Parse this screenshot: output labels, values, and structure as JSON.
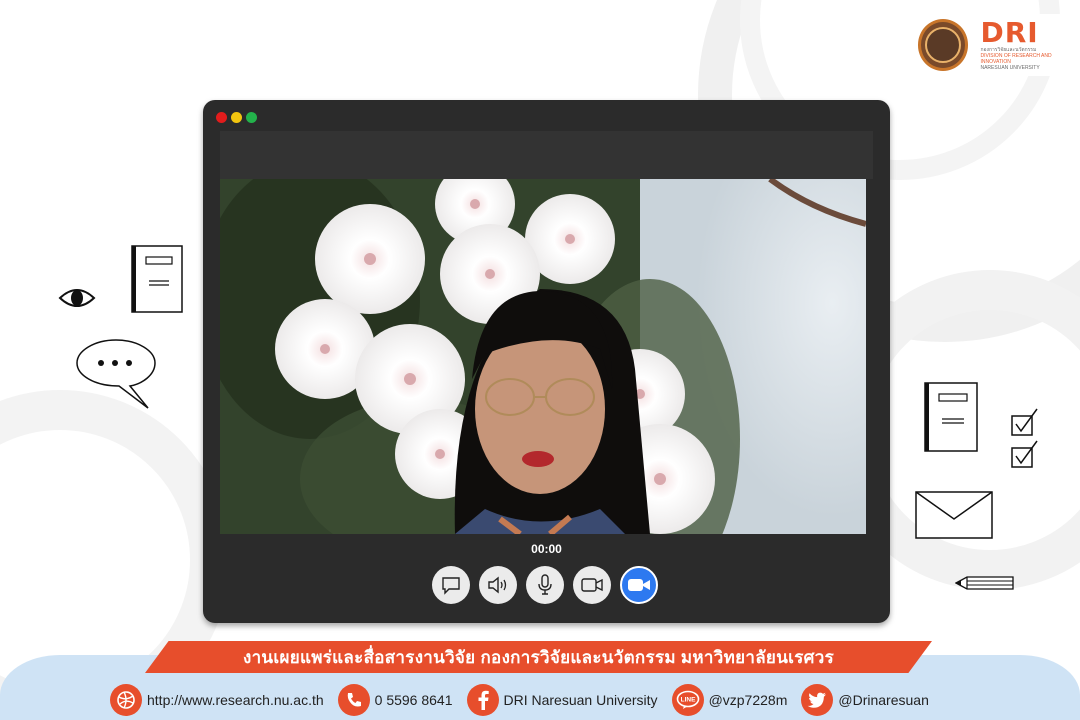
{
  "window": {
    "timer": "00:00",
    "traffic_lights": [
      "#e21c1c",
      "#f2c50f",
      "#23b24b"
    ],
    "controls": [
      {
        "name": "chat-button",
        "icon": "chat-bubble-icon"
      },
      {
        "name": "speaker-button",
        "icon": "speaker-icon"
      },
      {
        "name": "mic-button",
        "icon": "microphone-icon"
      },
      {
        "name": "camera-button",
        "icon": "video-camera-icon"
      },
      {
        "name": "zoom-button",
        "icon": "zoom-camera-icon",
        "active": true
      }
    ]
  },
  "logo": {
    "mark": "DRI",
    "subtitle_lines": [
      "กองการวิจัยและนวัตกรรม",
      "DIVISION OF RESEARCH AND INNOVATION",
      "NARESUAN UNIVERSITY"
    ]
  },
  "banner": {
    "title": "งานเผยแพร่และสื่อสารงานวิจัย กองการวิจัยและนวัตกรรม มหาวิทยาลัยนเรศวร"
  },
  "contacts": [
    {
      "icon": "globe-icon",
      "text": "http://www.research.nu.ac.th"
    },
    {
      "icon": "phone-icon",
      "text": "0 5596 8641"
    },
    {
      "icon": "facebook-icon",
      "text": "DRI Naresuan University"
    },
    {
      "icon": "line-icon",
      "text": "@vzp7228m",
      "icon_label": "LINE"
    },
    {
      "icon": "twitter-icon",
      "text": "@Drinaresuan"
    }
  ],
  "colors": {
    "accent": "#e74e2c",
    "window": "#2b2b2b",
    "zoom_blue": "#2d79f0",
    "footer": "#cfe3f5"
  }
}
